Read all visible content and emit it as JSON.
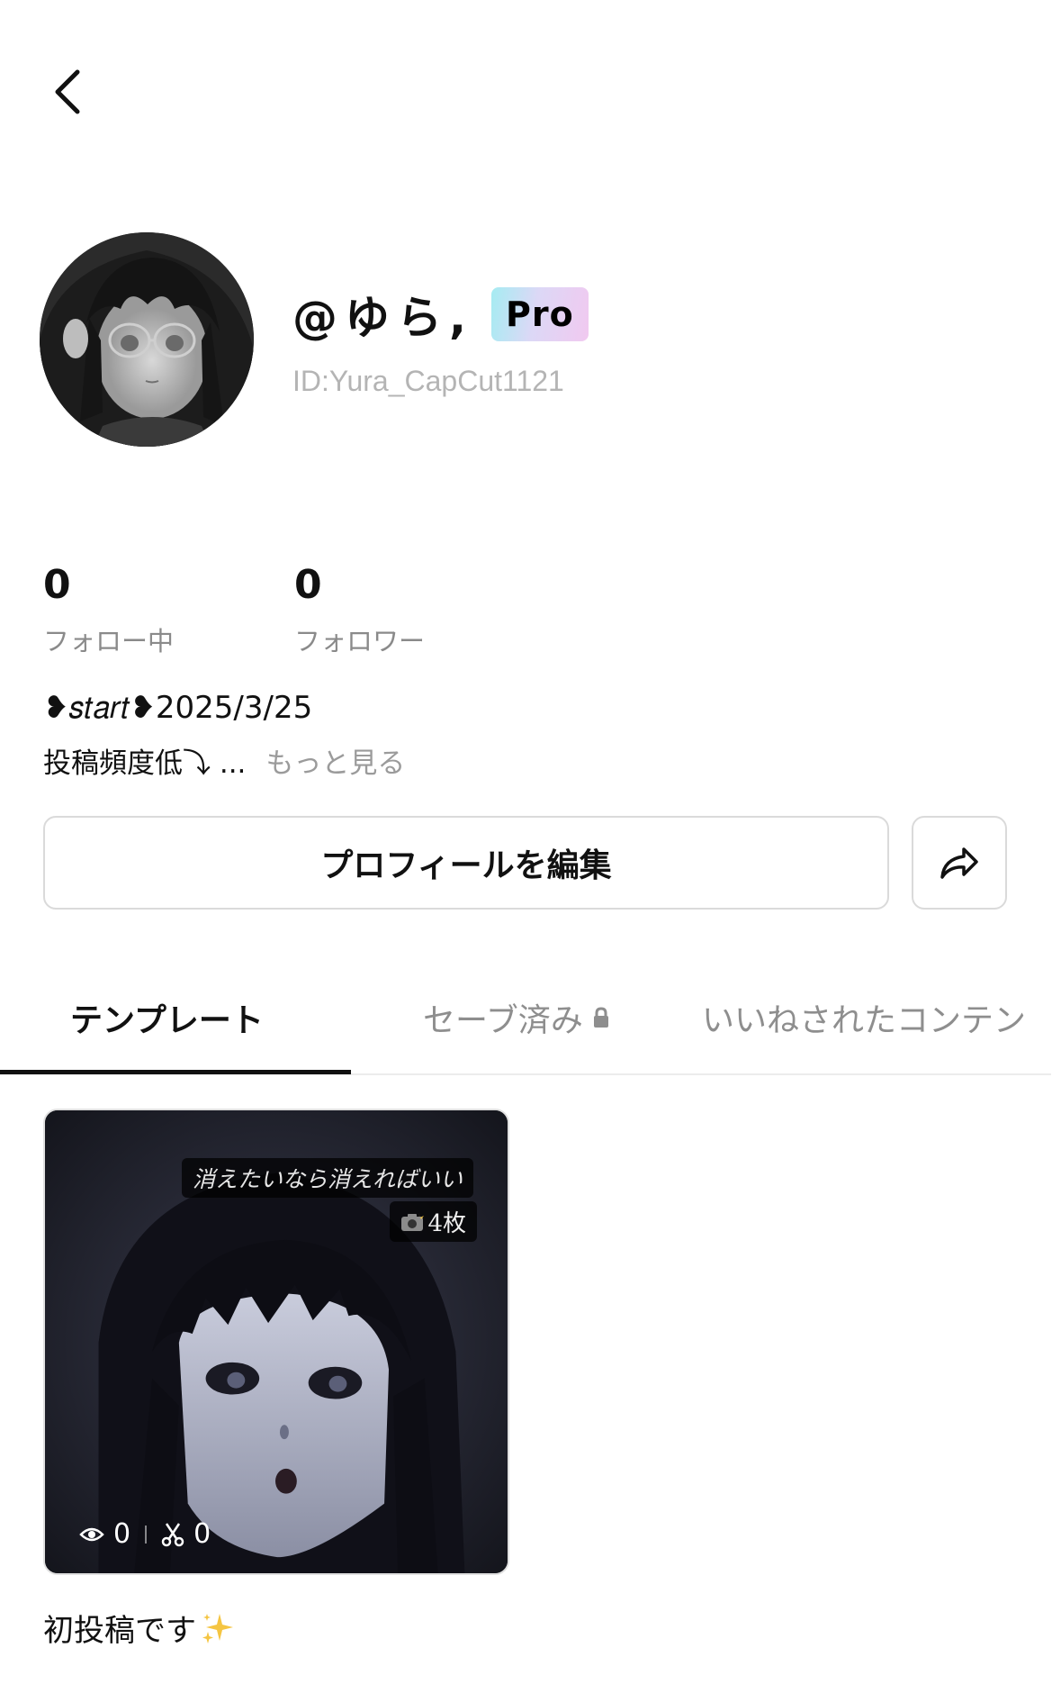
{
  "header": {
    "back_icon": "chevron-left-icon"
  },
  "profile": {
    "username": "@ゆら,",
    "badge": "Pro",
    "user_id": "ID:Yura_CapCut1121"
  },
  "stats": [
    {
      "value": "0",
      "label": "フォロー中"
    },
    {
      "value": "0",
      "label": "フォロワー"
    }
  ],
  "bio": {
    "line1": "❥𝑠𝑡𝑎𝑟𝑡❥2025/3/25",
    "line2": "投稿頻度低⤵︎ ...",
    "more_link": "もっと見る"
  },
  "actions": {
    "edit_profile": "プロフィールを編集",
    "share_icon": "share-arrow-icon"
  },
  "tabs": [
    {
      "label": "テンプレート",
      "active": true
    },
    {
      "label": "セーブ済み",
      "active": false,
      "icon": "lock-icon"
    },
    {
      "label": "いいねされたコンテン",
      "active": false
    }
  ],
  "templates": [
    {
      "caption": "消えたいなら消えればいい",
      "count": "4枚",
      "count_icon": "camera-flash-icon",
      "views": "0",
      "uses": "0",
      "title": "初投稿です",
      "title_emoji": "sparkles-icon"
    }
  ],
  "colors": {
    "text_primary": "#111111",
    "text_secondary": "#8a8a8a",
    "id_gray": "#b4b4b4",
    "border": "#dadada",
    "pro_gradient_start": "#a5ecf2",
    "pro_gradient_end": "#f1c9f0"
  }
}
